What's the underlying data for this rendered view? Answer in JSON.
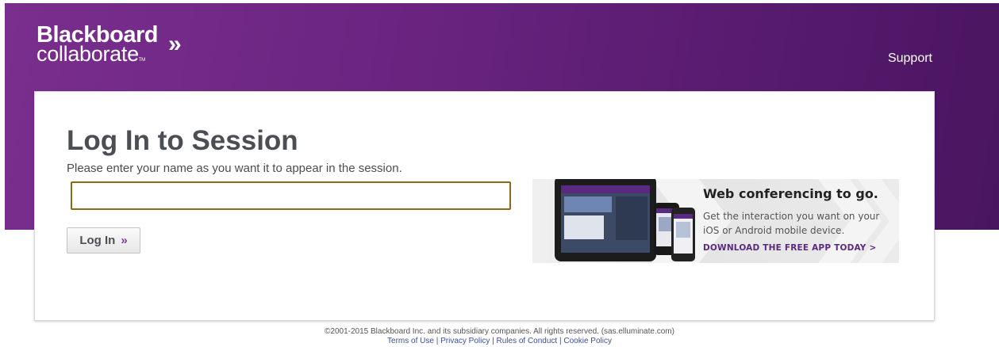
{
  "header": {
    "logo_line1": "Blackboard",
    "logo_line2": "collaborate",
    "logo_tm": "TM",
    "support_link": "Support"
  },
  "login": {
    "title": "Log In to Session",
    "instructions": "Please enter your name as you want it to appear in the session.",
    "name_value": "",
    "button_label": "Log In",
    "button_arrow": "»"
  },
  "promo": {
    "title": "Web conferencing to go.",
    "text": "Get the interaction you want on your iOS or Android mobile device.",
    "cta": "DOWNLOAD THE FREE APP TODAY >"
  },
  "footer": {
    "copyright": "©2001-2015 Blackboard Inc. and its subsidiary companies. All rights reserved. (sas.elluminate.com)",
    "links": [
      "Terms of Use",
      "Privacy Policy",
      "Rules of Conduct",
      "Cookie Policy"
    ],
    "separator": " | "
  },
  "colors": {
    "brand_purple": "#6a2480",
    "input_border": "#8c6a12",
    "link_blue": "#3a4fa0"
  },
  "icons": {
    "logo_chevron": "chevron-double-right-icon",
    "button_arrow": "double-arrow-right-icon"
  }
}
